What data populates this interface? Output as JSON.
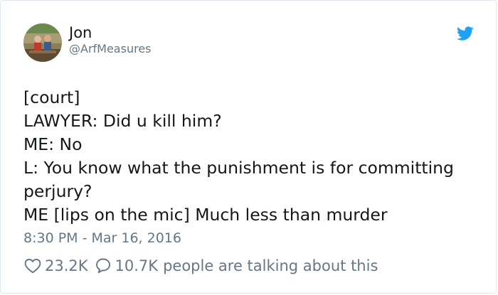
{
  "author": {
    "display_name": "Jon",
    "handle": "@ArfMeasures"
  },
  "icons": {
    "brand": "twitter-bird-icon",
    "like": "heart-icon",
    "reply": "speech-bubble-icon"
  },
  "colors": {
    "brand_blue": "#1da1f2",
    "text": "#14171a",
    "muted": "#657786"
  },
  "tweet": {
    "lines": [
      "[court]",
      "LAWYER: Did u kill him?",
      "ME: No",
      "L: You know what the punishment is for committing",
      "perjury?",
      "ME [lips on the mic] Much less than murder"
    ],
    "timestamp": "8:30 PM - Mar 16, 2016"
  },
  "engagement": {
    "likes": "23.2K",
    "replies": "10.7K",
    "talking_label": "people are talking about this"
  }
}
